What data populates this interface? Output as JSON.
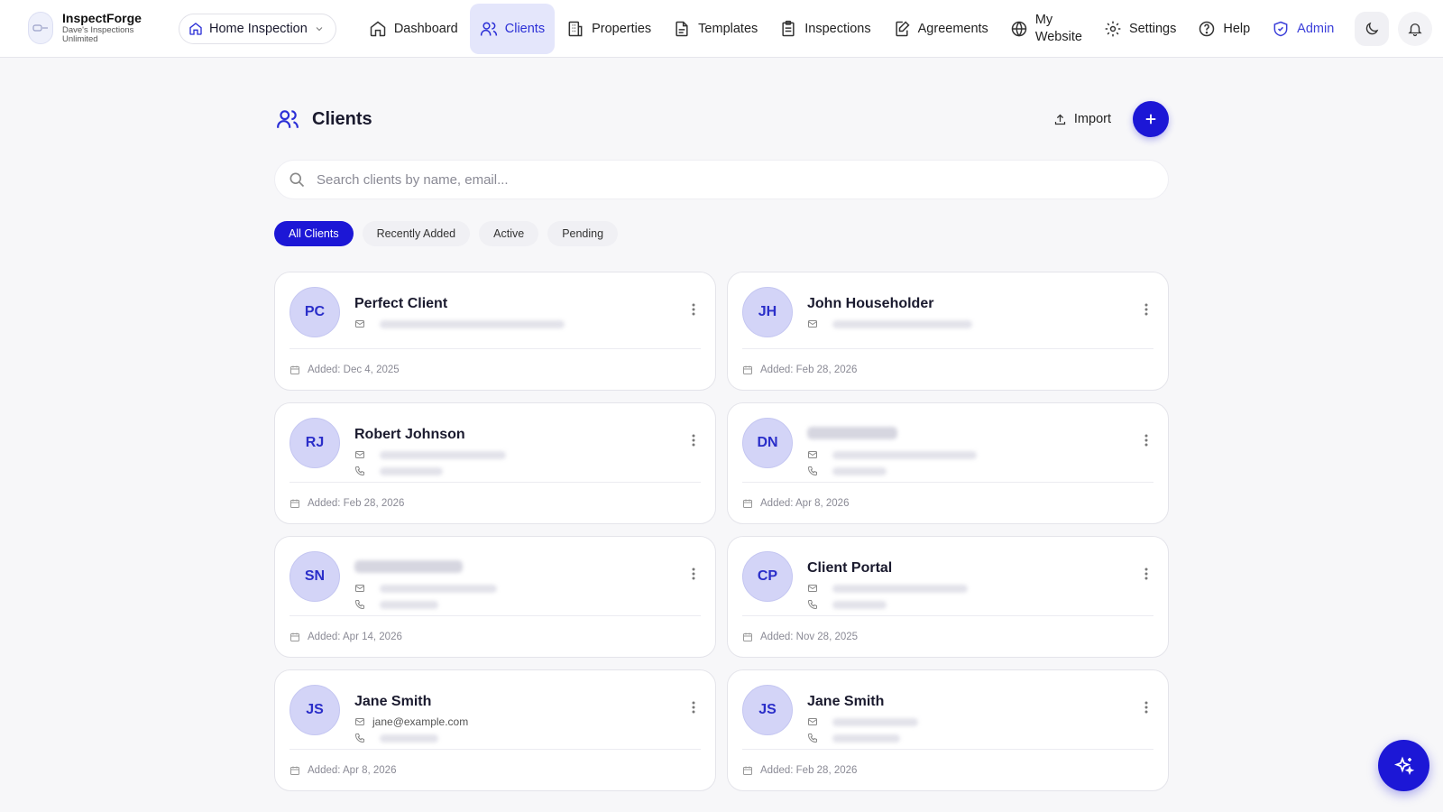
{
  "brand": {
    "name": "InspectForge",
    "subtitle_line1": "Dave's Inspections",
    "subtitle_line2": "Unlimited"
  },
  "workspace": {
    "label": "Home Inspection"
  },
  "nav": {
    "dashboard": "Dashboard",
    "clients": "Clients",
    "properties": "Properties",
    "templates": "Templates",
    "inspections": "Inspections",
    "agreements": "Agreements",
    "website_line1": "My",
    "website_line2": "Website",
    "settings": "Settings",
    "help": "Help",
    "admin": "Admin"
  },
  "page": {
    "title": "Clients",
    "import_label": "Import"
  },
  "search": {
    "placeholder": "Search clients by name, email..."
  },
  "filters": [
    "All Clients",
    "Recently Added",
    "Active",
    "Pending"
  ],
  "clients": [
    {
      "initials": "PC",
      "name": "Perfect Client",
      "email": "",
      "phone": "",
      "added": "Added: Dec 4, 2025"
    },
    {
      "initials": "JH",
      "name": "John Householder",
      "email": "",
      "phone": "",
      "added": "Added: Feb 28, 2026"
    },
    {
      "initials": "RJ",
      "name": "Robert Johnson",
      "email": "",
      "phone": "",
      "added": "Added: Feb 28, 2026"
    },
    {
      "initials": "DN",
      "name": "",
      "email": "",
      "phone": "",
      "added": "Added: Apr 8, 2026"
    },
    {
      "initials": "SN",
      "name": "",
      "email": "",
      "phone": "",
      "added": "Added: Apr 14, 2026"
    },
    {
      "initials": "CP",
      "name": "Client Portal",
      "email": "",
      "phone": "",
      "added": "Added: Nov 28, 2025"
    },
    {
      "initials": "JS",
      "name": "Jane Smith",
      "email": "jane@example.com",
      "phone": "",
      "added": "Added: Apr 8, 2026"
    },
    {
      "initials": "JS",
      "name": "Jane Smith",
      "email": "",
      "phone": "",
      "added": "Added: Feb 28, 2026"
    }
  ],
  "colors": {
    "accent": "#1c17d6",
    "avatar_bg": "#d3d4f7",
    "active_nav_bg": "#e4e6fb"
  }
}
